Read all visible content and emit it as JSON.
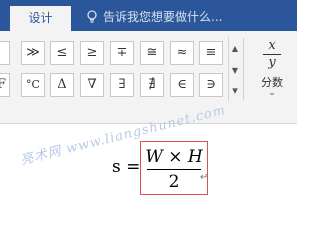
{
  "tabs": {
    "design": "设计"
  },
  "tell_me": {
    "text": "告诉我您想要做什么..."
  },
  "symbols": {
    "row1": [
      "≫",
      "≤",
      "≥",
      "∓",
      "≅",
      "≈",
      "≡"
    ],
    "row2": [
      "°C",
      "Δ",
      "∇",
      "∃",
      "∄",
      "∈",
      "∋"
    ],
    "row1_partial": "",
    "row2_partial": "F"
  },
  "scroll": {
    "up": "▲",
    "down": "▼",
    "more": "▾"
  },
  "fraction": {
    "numerator": "x",
    "denominator": "y",
    "label": "分数",
    "chevron": "⌄"
  },
  "watermark": "亮术网 www.liangshunet.com",
  "equation": {
    "lhs": "s =",
    "numerator": "W × H",
    "denominator": "2",
    "mark": "↵"
  },
  "colors": {
    "ribbon_blue": "#2b579a",
    "border_red": "#e05050"
  }
}
